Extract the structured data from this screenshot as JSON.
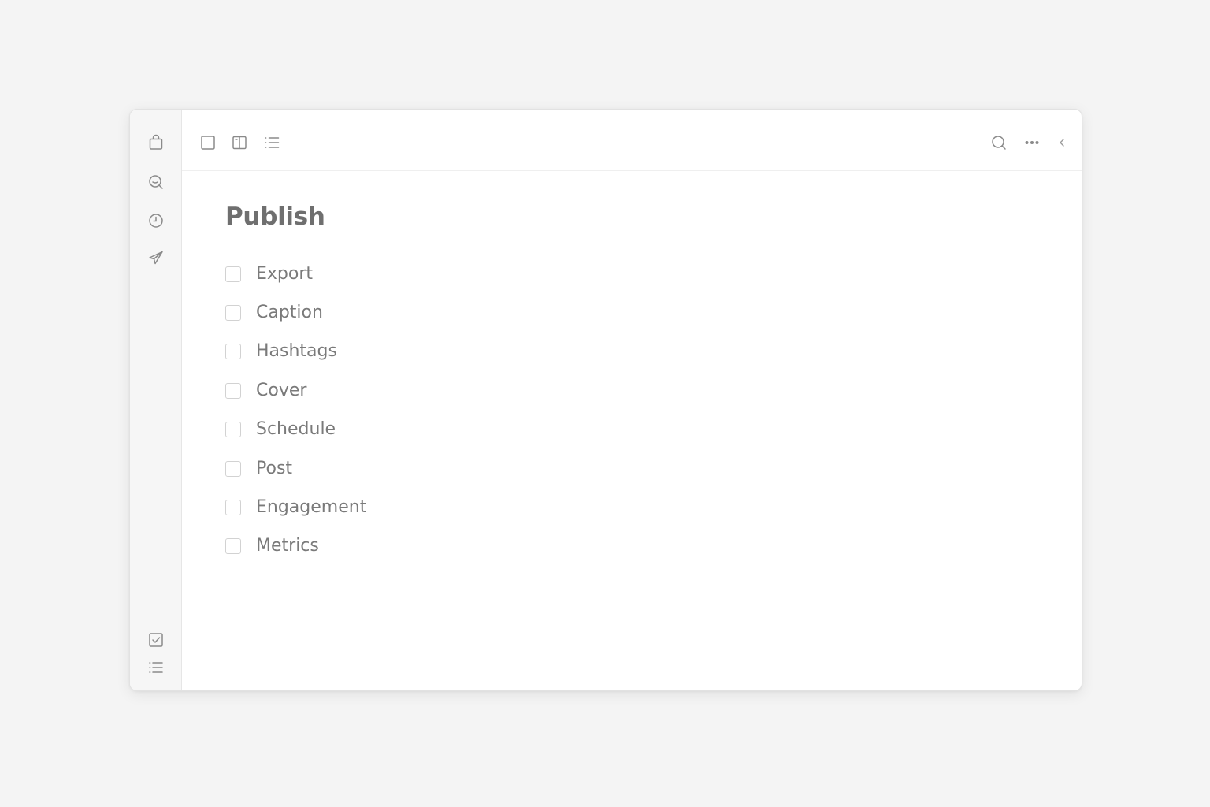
{
  "sidebar": {
    "top_icons": [
      "bag-icon",
      "search-chat-icon",
      "clock-icon",
      "send-icon"
    ],
    "bottom_icons": [
      "checkbox-icon",
      "list-icon"
    ]
  },
  "toolbar": {
    "left_icons": [
      "single-pane-icon",
      "split-pane-icon",
      "list-view-icon"
    ],
    "right_icons": [
      "search-icon",
      "more-icon",
      "chevron-left-icon"
    ]
  },
  "page": {
    "title": "Publish",
    "tasks": [
      {
        "label": "Export",
        "checked": false
      },
      {
        "label": "Caption",
        "checked": false
      },
      {
        "label": "Hashtags",
        "checked": false
      },
      {
        "label": "Cover",
        "checked": false
      },
      {
        "label": "Schedule",
        "checked": false
      },
      {
        "label": "Post",
        "checked": false
      },
      {
        "label": "Engagement",
        "checked": false
      },
      {
        "label": "Metrics",
        "checked": false
      }
    ]
  },
  "colors": {
    "background": "#f4f4f4",
    "window": "#ffffff",
    "sidebar": "#f6f6f6",
    "icon": "#8a8a8a",
    "title": "#6f6f6f",
    "text": "#7a7a7a",
    "checkbox_border": "#d2d2d2"
  }
}
